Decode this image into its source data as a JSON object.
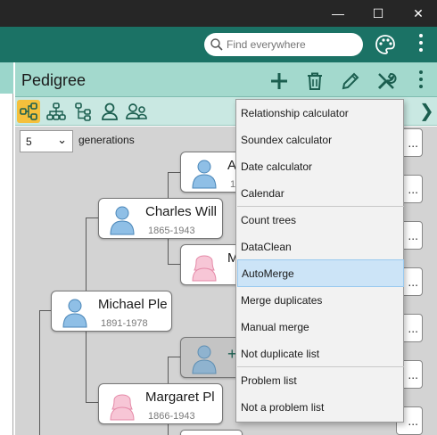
{
  "window": {
    "minimize_glyph": "—",
    "maximize_glyph": "☐",
    "close_glyph": "✕"
  },
  "header": {
    "search_placeholder": "Find everywhere",
    "icons": [
      "search-icon",
      "palette-icon",
      "more-vert-icon"
    ]
  },
  "panel": {
    "title": "Pedigree",
    "toolbar_icons": [
      "add-icon",
      "delete-icon",
      "edit-icon",
      "tools-icon",
      "more-vert-icon"
    ],
    "view_icons": [
      "pedigree-view-icon",
      "descendants-view-icon",
      "tree-view-icon",
      "person-icon",
      "family-icon"
    ],
    "next_glyph": "❯"
  },
  "generations": {
    "value": "5",
    "label": "generations",
    "caret": "⌄"
  },
  "people": {
    "michael": {
      "name": "Michael Ple",
      "dates": "1891-1978",
      "gender": "male"
    },
    "charles": {
      "name": "Charles Will",
      "dates": "1865-1943",
      "gender": "male"
    },
    "margaret": {
      "name": "Margaret Pl",
      "dates": "1866-1943",
      "gender": "female"
    },
    "a_partial": {
      "name": "A",
      "dates": "1",
      "gender": "male"
    },
    "m_partial": {
      "name": "M",
      "gender": "female"
    },
    "unknown": {
      "add_glyph": "+",
      "gender": "unknown"
    }
  },
  "right_cards": {
    "ellipsis": "..."
  },
  "menu": {
    "items": [
      "Relationship calculator",
      "Soundex calculator",
      "Date calculator",
      "Calendar",
      "Count trees",
      "DataClean",
      "AutoMerge",
      "Merge duplicates",
      "Manual merge",
      "Not duplicate list",
      "Problem list",
      "Not a problem list"
    ],
    "highlighted": "AutoMerge"
  },
  "colors": {
    "titlebar": "#262626",
    "app_header": "#1b7265",
    "panel_header": "#a3d9cd",
    "active_view": "#f5c03c",
    "male_avatar": "#8fbfe6",
    "female_avatar": "#f7c6d6",
    "menu_highlight": "#cce4f7"
  }
}
